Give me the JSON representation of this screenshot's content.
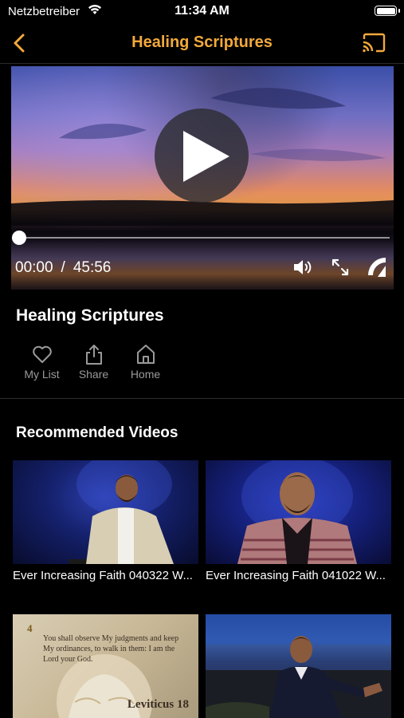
{
  "status_bar": {
    "carrier": "Netzbetreiber",
    "time": "11:34 AM"
  },
  "nav": {
    "title": "Healing Scriptures",
    "accent_color": "#f2a93b",
    "back_icon": "chevron-left-icon",
    "cast_icon": "cast-icon"
  },
  "player": {
    "current_time": "00:00",
    "separator": "/",
    "duration": "45:56",
    "progress": 0
  },
  "video": {
    "title": "Healing Scriptures"
  },
  "actions": [
    {
      "label": "My List",
      "icon": "heart-icon"
    },
    {
      "label": "Share",
      "icon": "share-icon"
    },
    {
      "label": "Home",
      "icon": "home-icon"
    }
  ],
  "recommended": {
    "heading": "Recommended Videos",
    "videos": [
      {
        "title": "Ever Increasing Faith 040322 W..."
      },
      {
        "title": "Ever Increasing Faith 041022 W..."
      },
      {
        "title": "",
        "thumb_verse_number": "4",
        "thumb_verse": "You shall observe My judgments and keep My ordinances, to walk in them: I am the Lord your God.",
        "thumb_reference": "Leviticus 18"
      },
      {
        "title": ""
      }
    ]
  }
}
